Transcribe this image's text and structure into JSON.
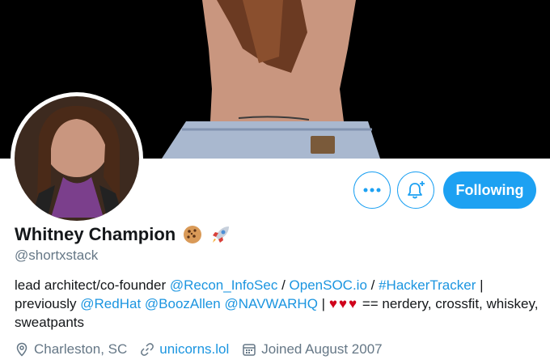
{
  "profile": {
    "display_name": "Whitney Champion",
    "name_emojis": [
      "cookie-emoji",
      "rocket-emoji"
    ],
    "handle": "@shortxstack"
  },
  "actions": {
    "more_icon": "more-icon",
    "notify_icon": "bell-plus-icon",
    "follow_label": "Following"
  },
  "bio": {
    "t1": "lead architect/co-founder ",
    "l1": "@Recon_InfoSec",
    "t2": " / ",
    "l2": "OpenSOC.io",
    "t3": " / ",
    "l3": "#HackerTracker",
    "t4": " | previously ",
    "l4": "@RedHat",
    "t5": " ",
    "l5": "@BoozAllen",
    "t6": " ",
    "l6": "@NAVWARHQ",
    "t7": " | ",
    "hearts": "♥♥♥",
    "t8": " == nerdery, crossfit, whiskey, sweatpants"
  },
  "meta": {
    "location": "Charleston, SC",
    "website": "unicorns.lol",
    "joined": "Joined August 2007"
  },
  "colors": {
    "accent": "#1da1f2",
    "link": "#1b95e0",
    "muted": "#657786",
    "heart": "#d0021b"
  }
}
